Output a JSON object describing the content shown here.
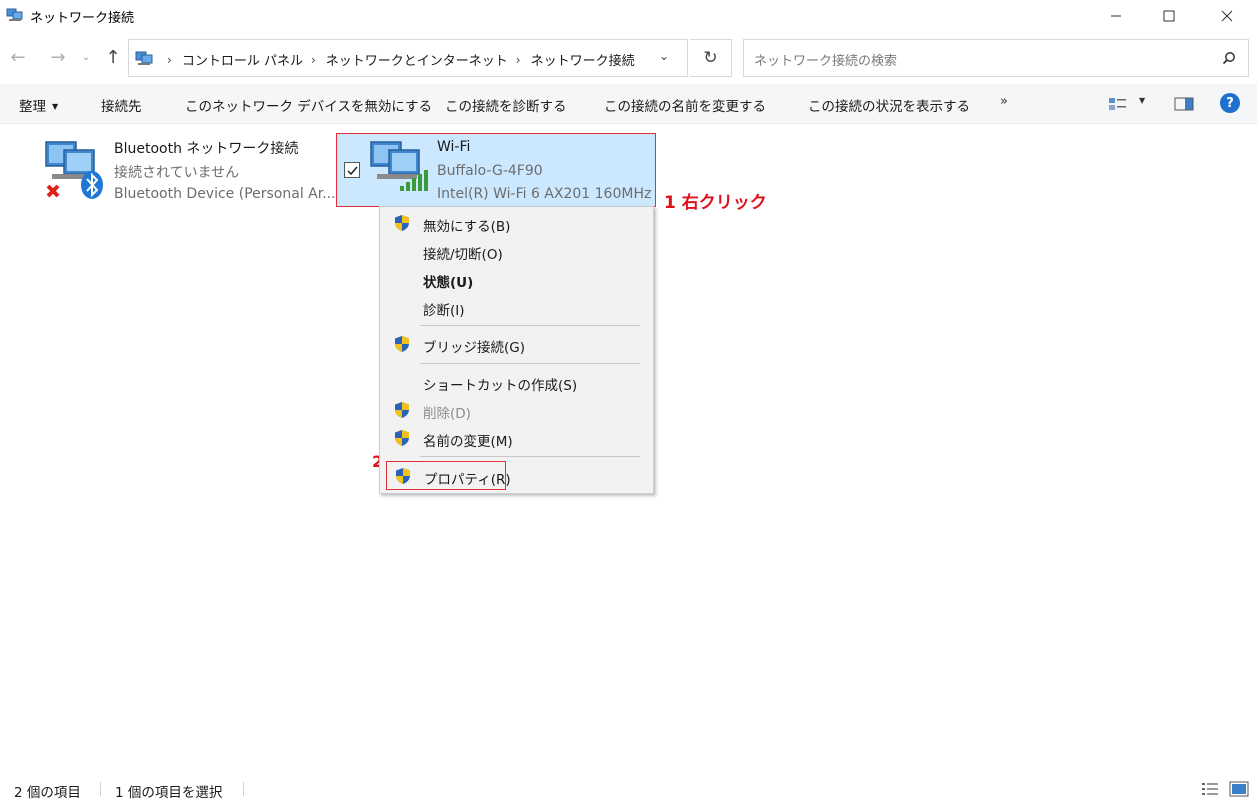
{
  "window": {
    "title": "ネットワーク接続",
    "minimize_icon": "minimize-icon",
    "maximize_icon": "maximize-icon",
    "close_icon": "close-icon"
  },
  "address_bar": {
    "breadcrumbs": [
      "コントロール パネル",
      "ネットワークとインターネット",
      "ネットワーク接続"
    ],
    "search_placeholder": "ネットワーク接続の検索"
  },
  "command_bar": {
    "organize": "整理",
    "connect_to": "接続先",
    "disable_device": "このネットワーク デバイスを無効にする",
    "diagnose": "この接続を診断する",
    "rename": "この接続の名前を変更する",
    "view_status": "この接続の状況を表示する",
    "more": "»",
    "help": "?"
  },
  "connections": [
    {
      "name": "Bluetooth ネットワーク接続",
      "status": "接続されていません",
      "device": "Bluetooth Device (Personal Ar..."
    },
    {
      "name": "Wi-Fi",
      "status": "Buffalo-G-4F90",
      "device": "Intel(R) Wi-Fi 6 AX201 160MHz"
    }
  ],
  "annotations": {
    "step1": "1 右クリック",
    "step2": "2"
  },
  "context_menu": {
    "items": [
      {
        "label": "無効にする(B)"
      },
      {
        "label": "接続/切断(O)"
      },
      {
        "label": "状態(U)"
      },
      {
        "label": "診断(I)"
      },
      {
        "label": "ブリッジ接続(G)"
      },
      {
        "label": "ショートカットの作成(S)"
      },
      {
        "label": "削除(D)"
      },
      {
        "label": "名前の変更(M)"
      },
      {
        "label": "プロパティ(R)"
      }
    ]
  },
  "status_bar": {
    "item_count": "2 個の項目",
    "selected_count": "1 個の項目を選択"
  },
  "colors": {
    "selection_bg": "#cce8ff",
    "highlight_red": "#e0101a",
    "help_blue": "#1f6fd1"
  }
}
